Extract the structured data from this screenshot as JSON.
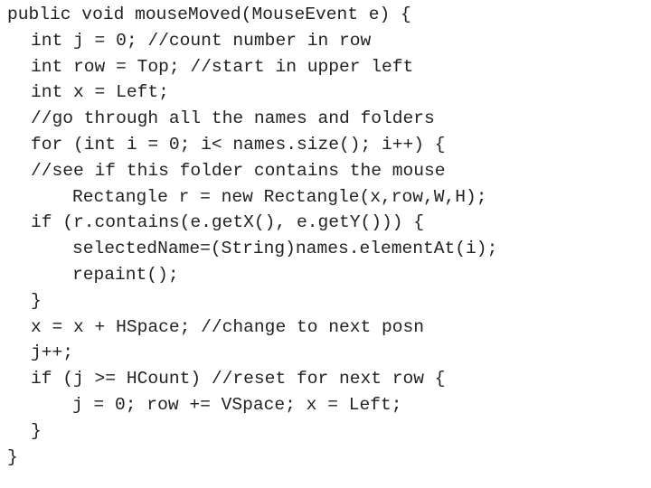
{
  "code": {
    "language": "java",
    "lines": [
      {
        "indent": 0,
        "text": "public void mouseMoved(MouseEvent e) {"
      },
      {
        "indent": 1,
        "text": "int j = 0; //count number in row"
      },
      {
        "indent": 1,
        "text": "int row = Top; //start in upper left"
      },
      {
        "indent": 1,
        "text": "int x = Left;"
      },
      {
        "indent": 1,
        "text": "//go through all the names and folders"
      },
      {
        "indent": 1,
        "text": "for (int i = 0; i< names.size(); i++) {"
      },
      {
        "indent": 1,
        "text": "//see if this folder contains the mouse"
      },
      {
        "indent": 2,
        "text": "Rectangle r = new Rectangle(x,row,W,H);"
      },
      {
        "indent": 1,
        "text": "if (r.contains(e.getX(), e.getY())) {"
      },
      {
        "indent": 2,
        "text": "selectedName=(String)names.elementAt(i);"
      },
      {
        "indent": 2,
        "text": "repaint();"
      },
      {
        "indent": 1,
        "text": "}"
      },
      {
        "indent": 1,
        "text": "x = x + HSpace; //change to next posn"
      },
      {
        "indent": 1,
        "text": "j++;"
      },
      {
        "indent": 1,
        "text": "if (j >= HCount) //reset for next row {"
      },
      {
        "indent": 2,
        "text": "j = 0; row += VSpace; x = Left;"
      },
      {
        "indent": 1,
        "text": "}"
      },
      {
        "indent": 0,
        "text": "}"
      }
    ]
  }
}
